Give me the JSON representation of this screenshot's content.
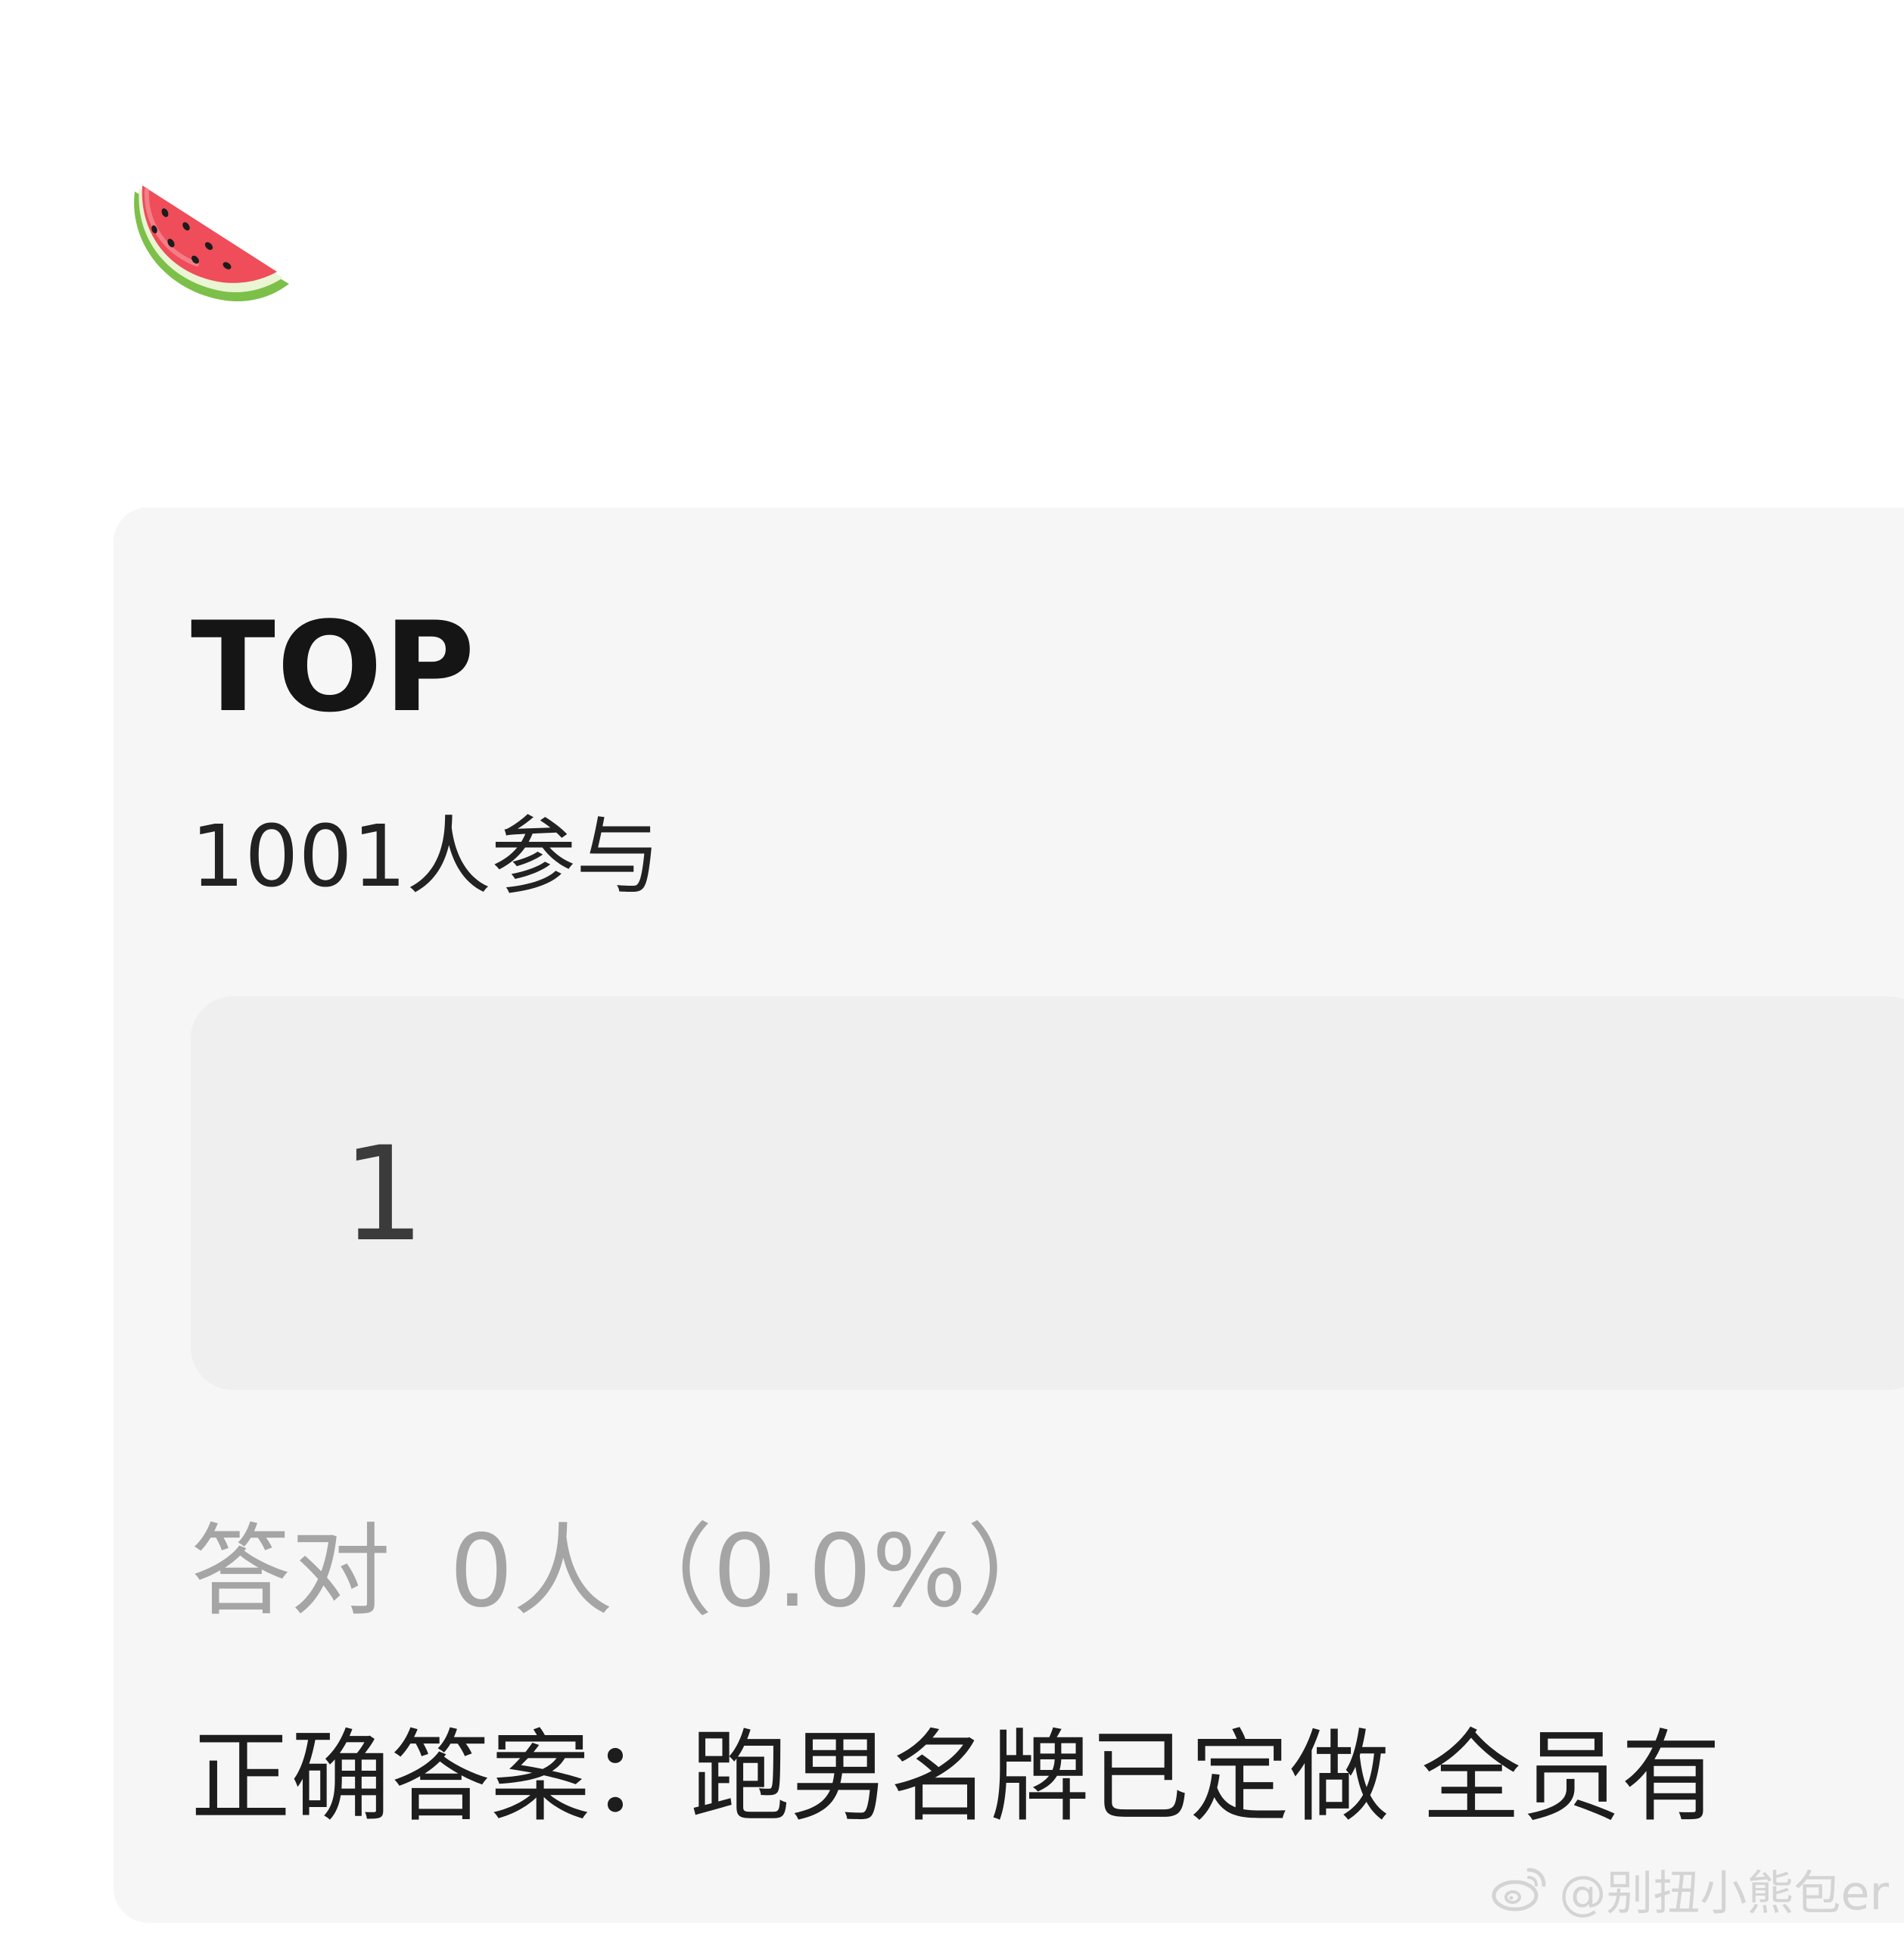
{
  "header": {
    "emoji_icon": "watermelon-icon"
  },
  "quiz": {
    "title": "TOP",
    "participants": "1001人参与",
    "option": {
      "number": "1"
    },
    "correct_label": "答对",
    "correct_value": "0人（0.0%）",
    "answer": "正确答案：跑男名牌已定做 全员有"
  },
  "watermark": {
    "icon": "weibo-logo-icon",
    "text": "@别扭小熊包er"
  },
  "colors": {
    "card_bg": "#f6f6f6",
    "option_bg": "#efefef",
    "title_text": "#151515",
    "muted_text": "#a5a5a5",
    "watermark_text": "#d4d4d4"
  }
}
